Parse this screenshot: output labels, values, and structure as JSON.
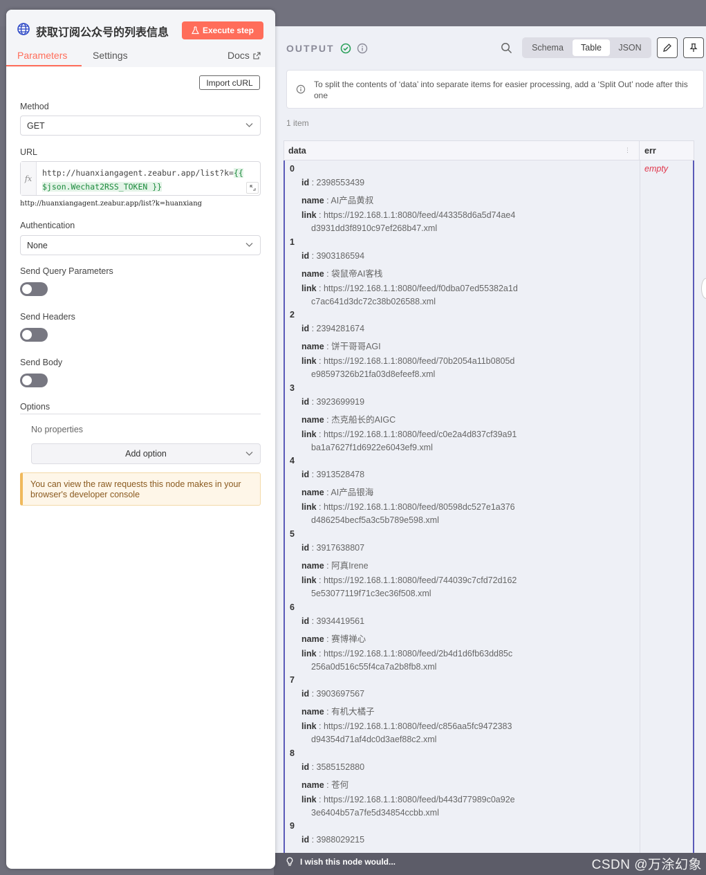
{
  "node": {
    "title": "获取订阅公众号的列表信息",
    "execute_label": "Execute step",
    "tabs": [
      "Parameters",
      "Settings"
    ],
    "docs_label": "Docs",
    "import_curl_label": "Import cURL"
  },
  "params": {
    "method_label": "Method",
    "method_value": "GET",
    "url_label": "URL",
    "url_prefix": "http://huanxiangagent.zeabur.app/list?k=",
    "url_expr_open": "{{",
    "url_expr_body": "$json.Wechat2RSS_TOKEN }}",
    "fx_label": "fx",
    "url_preview": "http://huanxiangagent.zeabur.app/list?k=huanxiang",
    "auth_label": "Authentication",
    "auth_value": "None",
    "send_query_label": "Send Query Parameters",
    "send_headers_label": "Send Headers",
    "send_body_label": "Send Body",
    "options_label": "Options",
    "no_properties": "No properties",
    "add_option_label": "Add option",
    "notice": "You can view the raw requests this node makes in your browser's developer console"
  },
  "toggles": {
    "send_query": false,
    "send_headers": false,
    "send_body": false
  },
  "output": {
    "label": "OUTPUT",
    "views": [
      "Schema",
      "Table",
      "JSON"
    ],
    "active_view": "Table",
    "hint": "To split the contents of ‘data’ into separate items for easier processing, add a ‘Split Out’ node after this one",
    "items_count": "1 item",
    "col_data": "data",
    "col_err": "err",
    "err_value": "empty",
    "key_id": "id",
    "key_name": "name",
    "key_link": "link",
    "rows": [
      {
        "idx": "0",
        "id": "2398553439",
        "name": "AI产品黄叔",
        "link1": "https://192.168.1.1:8080/feed/443358d6a5d74ae4",
        "link2": "d3931dd3f8910c97ef268b47.xml"
      },
      {
        "idx": "1",
        "id": "3903186594",
        "name": "袋鼠帝AI客栈",
        "link1": "https://192.168.1.1:8080/feed/f0dba07ed55382a1d",
        "link2": "c7ac641d3dc72c38b026588.xml"
      },
      {
        "idx": "2",
        "id": "2394281674",
        "name": "饼干哥哥AGI",
        "link1": "https://192.168.1.1:8080/feed/70b2054a11b0805d",
        "link2": "e98597326b21fa03d8efeef8.xml"
      },
      {
        "idx": "3",
        "id": "3923699919",
        "name": "杰克船长的AIGC",
        "link1": "https://192.168.1.1:8080/feed/c0e2a4d837cf39a91",
        "link2": "ba1a7627f1d6922e6043ef9.xml"
      },
      {
        "idx": "4",
        "id": "3913528478",
        "name": "AI产品银海",
        "link1": "https://192.168.1.1:8080/feed/80598dc527e1a376",
        "link2": "d486254becf5a3c5b789e598.xml"
      },
      {
        "idx": "5",
        "id": "3917638807",
        "name": "阿真Irene",
        "link1": "https://192.168.1.1:8080/feed/744039c7cfd72d162",
        "link2": "5e53077119f71c3ec36f508.xml"
      },
      {
        "idx": "6",
        "id": "3934419561",
        "name": "赛博禅心",
        "link1": "https://192.168.1.1:8080/feed/2b4d1d6fb63dd85c",
        "link2": "256a0d516c55f4ca7a2b8fb8.xml"
      },
      {
        "idx": "7",
        "id": "3903697567",
        "name": "有机大橘子",
        "link1": "https://192.168.1.1:8080/feed/c856aa5fc9472383",
        "link2": "d94354d71af4dc0d3aef88c2.xml"
      },
      {
        "idx": "8",
        "id": "3585152880",
        "name": "苍何",
        "link1": "https://192.168.1.1:8080/feed/b443d77989c0a92e",
        "link2": "3e6404b57a7fe5d34854ccbb.xml"
      },
      {
        "idx": "9",
        "id": "3988029215",
        "name": "",
        "link1": "",
        "link2": ""
      }
    ]
  },
  "footer": {
    "wish": "I wish this node would...",
    "watermark": "CSDN @万涂幻象"
  },
  "colors": {
    "accent": "#ff6d5a",
    "success": "#2aa05a",
    "table_border": "#5a5ab8",
    "err": "#e0364b"
  }
}
